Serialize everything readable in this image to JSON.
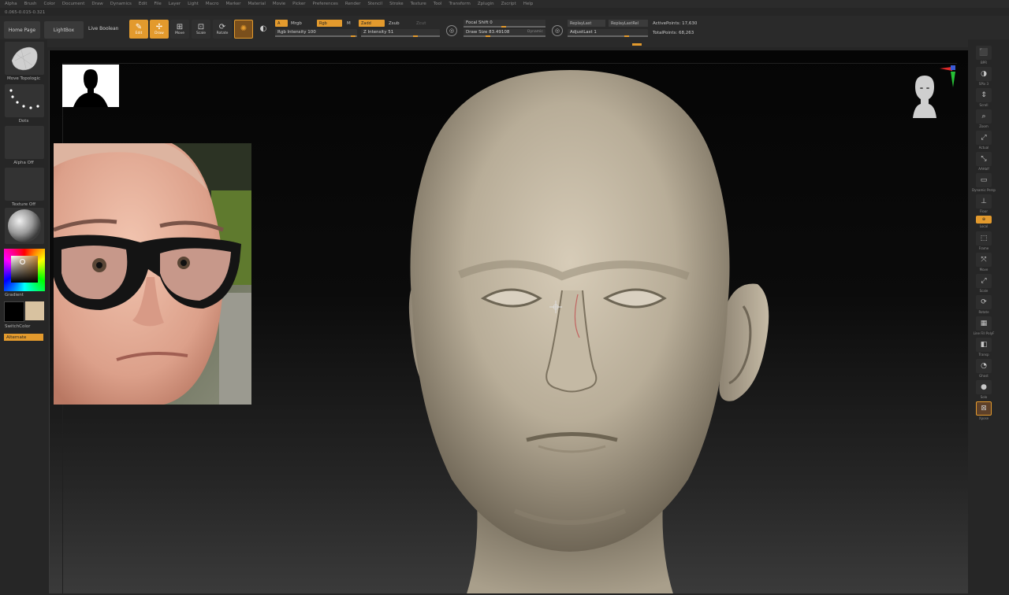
{
  "menu": [
    "Alpha",
    "Brush",
    "Color",
    "Document",
    "Draw",
    "Dynamics",
    "Edit",
    "File",
    "Layer",
    "Light",
    "Macro",
    "Marker",
    "Material",
    "Movie",
    "Picker",
    "Preferences",
    "Render",
    "Stencil",
    "Stroke",
    "Texture",
    "Tool",
    "Transform",
    "Zplugin",
    "Zscript",
    "Help"
  ],
  "statusline": "0.065-0.015-0.321",
  "nav": {
    "home": "Home Page",
    "lightbox": "LightBox",
    "boolean": "Live Boolean"
  },
  "tools": {
    "edit": "Edit",
    "draw": "Draw",
    "move": "Move",
    "scale": "Scale",
    "rotate": "Rotate"
  },
  "controls": {
    "a": "A",
    "mrgb": "Mrgb",
    "rgb": "Rgb",
    "m": "M",
    "zadd": "Zadd",
    "zsub": "Zsub",
    "zcut": "Zcut",
    "rgb_intensity": "Rgb Intensity 100",
    "z_intensity": "Z Intensity 51",
    "focal_shift": "Focal Shift 0",
    "draw_size": "Draw Size 83.49108",
    "dynamic": "Dynamic",
    "replay_last": "ReplayLast",
    "replay_last_rel": "ReplayLastRel",
    "adjust_last": "AdjustLast 1",
    "active_points": "ActivePoints: 17,630",
    "total_points": "TotalPoints: 68,263"
  },
  "left": {
    "move_label": "Move Topologic",
    "dots_label": "Dots",
    "alpha_label": "Alpha Off",
    "texture_label": "Texture Off",
    "gradient_label": "Gradient",
    "switch_label": "SwitchColor",
    "alternate_label": "Alternate"
  },
  "right": {
    "labels": [
      "BPR",
      "SPix 3",
      "Scroll",
      "Zoom",
      "Actual",
      "AAHalf",
      "Dynamic Persp",
      "Floor",
      "Local",
      "Frame",
      "Move",
      "Scale",
      "Rotate",
      "Line Fill PolyF",
      "Transp",
      "Ghost",
      "Solo",
      "Xpose"
    ],
    "spix": "SPix 3",
    "active": "Qxyz"
  },
  "colors": {
    "accent": "#e39a2d",
    "primary_color": "#000000",
    "secondary_color": "#d8c2a0",
    "sculpt_clay": "#b8ad98"
  }
}
